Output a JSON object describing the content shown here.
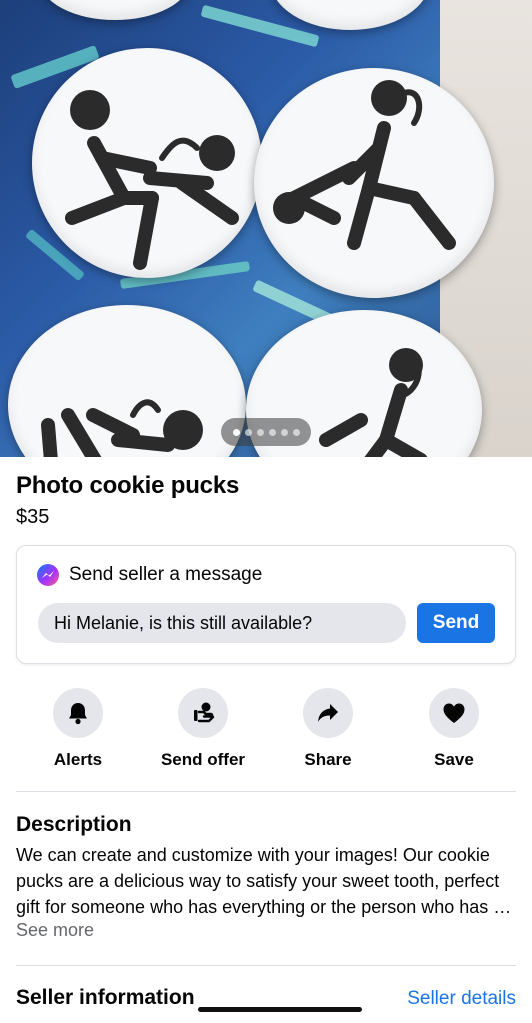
{
  "listing": {
    "title": "Photo cookie pucks",
    "price": "$35"
  },
  "photo": {
    "pager_count": 6,
    "active_index": 0
  },
  "message": {
    "heading": "Send seller a message",
    "input_value": "Hi Melanie, is this still available?",
    "send_label": "Send"
  },
  "actions": [
    {
      "label": "Alerts",
      "icon": "bell-icon"
    },
    {
      "label": "Send offer",
      "icon": "send-offer-icon"
    },
    {
      "label": "Share",
      "icon": "share-icon"
    },
    {
      "label": "Save",
      "icon": "heart-icon"
    }
  ],
  "description": {
    "heading": "Description",
    "body": "We can create and customize with your images! Our cookie pucks are a delicious way to satisfy your sweet tooth, perfect gift for someone who has everything or the person who has a sweet tooth!",
    "see_more": "See more"
  },
  "seller": {
    "heading": "Seller information",
    "details_link": "Seller details"
  },
  "colors": {
    "accent": "#1b74e4",
    "secondary_text": "#65676b",
    "button_bg": "#e4e6eb"
  }
}
